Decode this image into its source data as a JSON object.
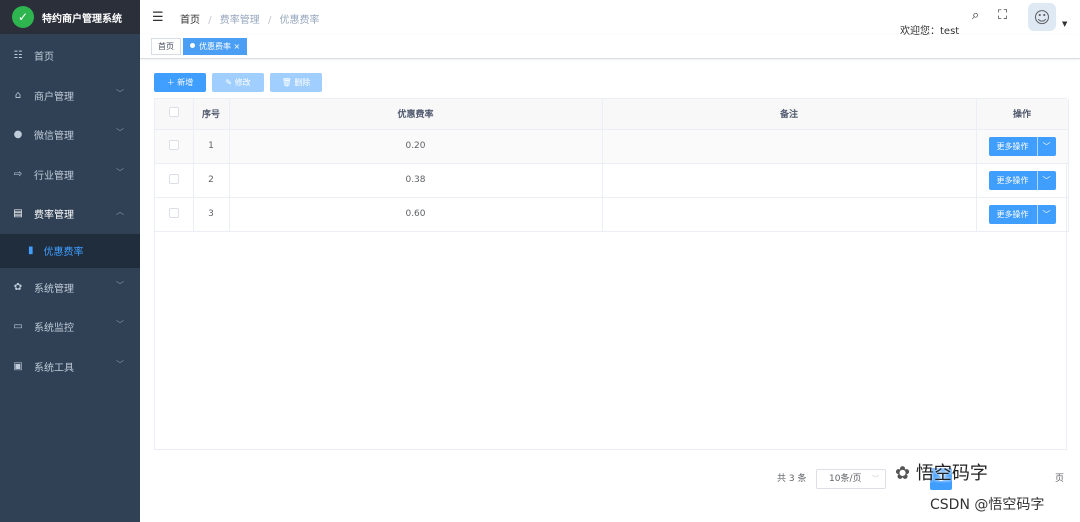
{
  "app": {
    "title": "特约商户管理系统"
  },
  "sidebar": {
    "items": [
      {
        "label": "首页",
        "icon": "dashboard-icon",
        "glyph": "☷"
      },
      {
        "label": "商户管理",
        "icon": "shop-icon",
        "glyph": "⌂"
      },
      {
        "label": "微信管理",
        "icon": "wechat-icon",
        "glyph": "●"
      },
      {
        "label": "行业管理",
        "icon": "industry-icon",
        "glyph": "⇨"
      },
      {
        "label": "费率管理",
        "icon": "rate-icon",
        "glyph": "▤"
      },
      {
        "label": "优惠费率",
        "icon": "discount-rate-icon",
        "glyph": "▮"
      },
      {
        "label": "系统管理",
        "icon": "settings-icon",
        "glyph": "✿"
      },
      {
        "label": "系统监控",
        "icon": "monitor-icon",
        "glyph": "▭"
      },
      {
        "label": "系统工具",
        "icon": "toolbox-icon",
        "glyph": "▣"
      }
    ]
  },
  "navbar": {
    "breadcrumb": [
      "首页",
      "费率管理",
      "优惠费率"
    ],
    "welcome": "欢迎您：test"
  },
  "tags": [
    {
      "label": "首页"
    },
    {
      "label": "优惠费率 ×"
    }
  ],
  "toolbar": {
    "add_label": "＋ 新增",
    "edit_label": "✎ 修改",
    "delete_label": "🗑 删除"
  },
  "table": {
    "headers": [
      "序号",
      "优惠费率",
      "备注",
      "操作"
    ],
    "rows": [
      {
        "index": "1",
        "rate": "0.20",
        "remark": "",
        "action": "更多操作"
      },
      {
        "index": "2",
        "rate": "0.38",
        "remark": "",
        "action": "更多操作"
      },
      {
        "index": "3",
        "rate": "0.60",
        "remark": "",
        "action": "更多操作"
      }
    ]
  },
  "pagination": {
    "total": "共 3 条",
    "page_size": "10条/页",
    "current_page": "1",
    "suffix": "页"
  },
  "watermark": {
    "wechat": "悟空码字",
    "csdn": "CSDN @悟空码字"
  },
  "colors": {
    "sidebar_bg": "#304156",
    "primary": "#409eff",
    "active_menu": "#409eff"
  }
}
